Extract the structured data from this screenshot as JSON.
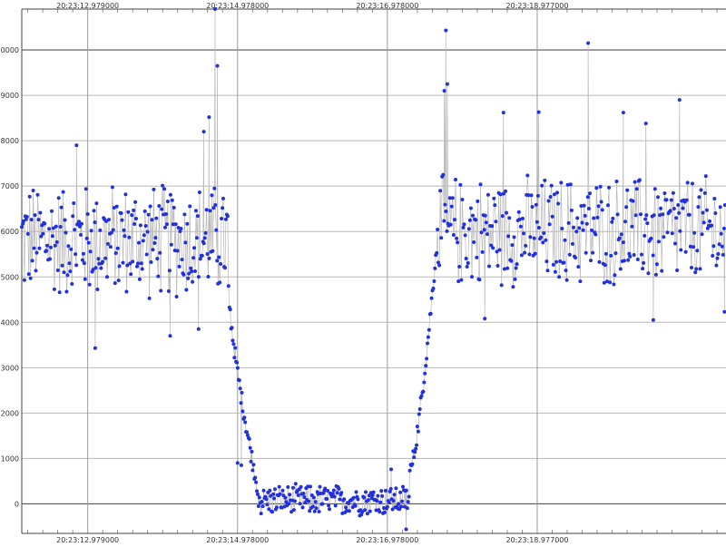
{
  "chart_data": {
    "type": "line",
    "title": "",
    "xlabel": "",
    "ylabel": "",
    "x_ticks": [
      "20:23:12.979000",
      "20:23:14.978000",
      "20:23:16.978000",
      "20:23:18.977000"
    ],
    "x_tick_values": [
      0.0,
      2.0,
      4.0,
      6.0
    ],
    "xlim": [
      -0.88,
      8.52
    ],
    "y_ticks": [
      0,
      1000,
      2000,
      3000,
      4000,
      5000,
      6000,
      7000,
      8000,
      9000,
      10000
    ],
    "ylim": [
      -650,
      10900
    ],
    "grid": true,
    "series": [
      {
        "color": "#2230e0",
        "line_color": "#b9b9b9",
        "segments": [
          {
            "x0": -0.88,
            "x1": 1.88,
            "n": 235,
            "pattern": "noise",
            "mean": 5800,
            "amp": 1400,
            "spikes": [
              [
                0.1,
                3430
              ],
              [
                -0.15,
                7900
              ],
              [
                1.1,
                3700
              ],
              [
                1.55,
                8200
              ],
              [
                1.62,
                8520
              ],
              [
                1.7,
                10900
              ],
              [
                1.73,
                9650
              ],
              [
                1.48,
                3850
              ]
            ]
          },
          {
            "x0": 1.88,
            "x1": 2.28,
            "n": 36,
            "pattern": "ramp_down",
            "from": 4700,
            "to": 350
          },
          {
            "x0": 2.28,
            "x1": 4.3,
            "n": 175,
            "pattern": "noise",
            "mean": 80,
            "amp": 380,
            "spikes": [
              [
                2.0,
                900
              ],
              [
                2.05,
                850
              ],
              [
                4.05,
                760
              ],
              [
                4.25,
                -560
              ]
            ]
          },
          {
            "x0": 4.3,
            "x1": 4.68,
            "n": 34,
            "pattern": "ramp_up",
            "from": 700,
            "to": 5900
          },
          {
            "x0": 4.68,
            "x1": 8.52,
            "n": 300,
            "pattern": "noise",
            "mean": 6000,
            "amp": 1350,
            "spikes": [
              [
                4.78,
                10430
              ],
              [
                4.8,
                9250
              ],
              [
                4.76,
                9100
              ],
              [
                5.3,
                4080
              ],
              [
                5.55,
                8620
              ],
              [
                6.02,
                8630
              ],
              [
                6.68,
                10150
              ],
              [
                7.15,
                8620
              ],
              [
                7.45,
                8380
              ],
              [
                7.9,
                8900
              ],
              [
                7.55,
                4050
              ],
              [
                8.5,
                4230
              ]
            ]
          }
        ]
      }
    ]
  }
}
